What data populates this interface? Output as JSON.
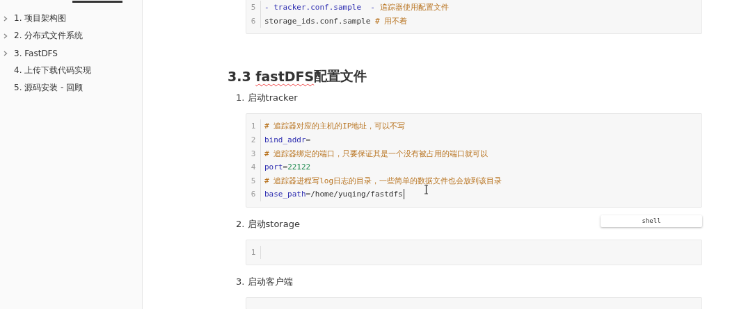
{
  "sidebar": {
    "items": [
      {
        "label": "1. 项目架构图",
        "collapsible": true
      },
      {
        "label": "2. 分布式文件系统",
        "collapsible": true
      },
      {
        "label": "3. FastDFS",
        "collapsible": true
      },
      {
        "label": "4. 上传下载代码实现",
        "collapsible": false
      },
      {
        "label": "5. 源码安装 - 回顾",
        "collapsible": false
      }
    ]
  },
  "content": [
    {
      "kind": "code",
      "lines": [
        {
          "number": "5",
          "tokens": [
            {
              "kind": "keyword",
              "text": "- tracker.conf.sample  - "
            },
            {
              "kind": "comment",
              "text": "追踪器使用配置文件"
            }
          ]
        },
        {
          "number": "6",
          "tokens": [
            {
              "kind": "plain",
              "text": "storage_ids.conf.sample "
            },
            {
              "kind": "comment",
              "text": "# 用不着"
            }
          ]
        }
      ]
    },
    {
      "kind": "heading",
      "parts": [
        {
          "text": "3.3 ",
          "misspelled": false
        },
        {
          "text": "fastDFS",
          "misspelled": true
        },
        {
          "text": "配置文件",
          "misspelled": false
        }
      ]
    },
    {
      "kind": "list_item",
      "text": "1. 启动tracker"
    },
    {
      "kind": "code",
      "lines": [
        {
          "number": "1",
          "tokens": [
            {
              "kind": "comment",
              "text": "# 追踪器对应的主机的IP地址，可以不写"
            }
          ]
        },
        {
          "number": "2",
          "tokens": [
            {
              "kind": "keyword",
              "text": "bind_addr"
            },
            {
              "kind": "operator",
              "text": "="
            }
          ]
        },
        {
          "number": "3",
          "tokens": [
            {
              "kind": "comment",
              "text": "# 追踪器绑定的端口，只要保证其是一个没有被占用的端口就可以"
            }
          ]
        },
        {
          "number": "4",
          "tokens": [
            {
              "kind": "keyword",
              "text": "port"
            },
            {
              "kind": "operator",
              "text": "="
            },
            {
              "kind": "number",
              "text": "22122"
            }
          ]
        },
        {
          "number": "5",
          "tokens": [
            {
              "kind": "comment",
              "text": "# 追踪器进程写log日志的目录，一些简单的数据文件也会放到该目录"
            }
          ]
        },
        {
          "number": "6",
          "cursor": true,
          "tokens": [
            {
              "kind": "keyword",
              "text": "base_path"
            },
            {
              "kind": "operator",
              "text": "="
            },
            {
              "kind": "plain",
              "text": "/home/yuqing/fastdfs"
            }
          ]
        }
      ],
      "language": "shell"
    },
    {
      "kind": "list_item",
      "text": "2. 启动storage"
    },
    {
      "kind": "code",
      "lines": [
        {
          "number": "1"
        }
      ]
    },
    {
      "kind": "list_item",
      "text": "3. 启动客户端"
    },
    {
      "kind": "code"
    }
  ]
}
